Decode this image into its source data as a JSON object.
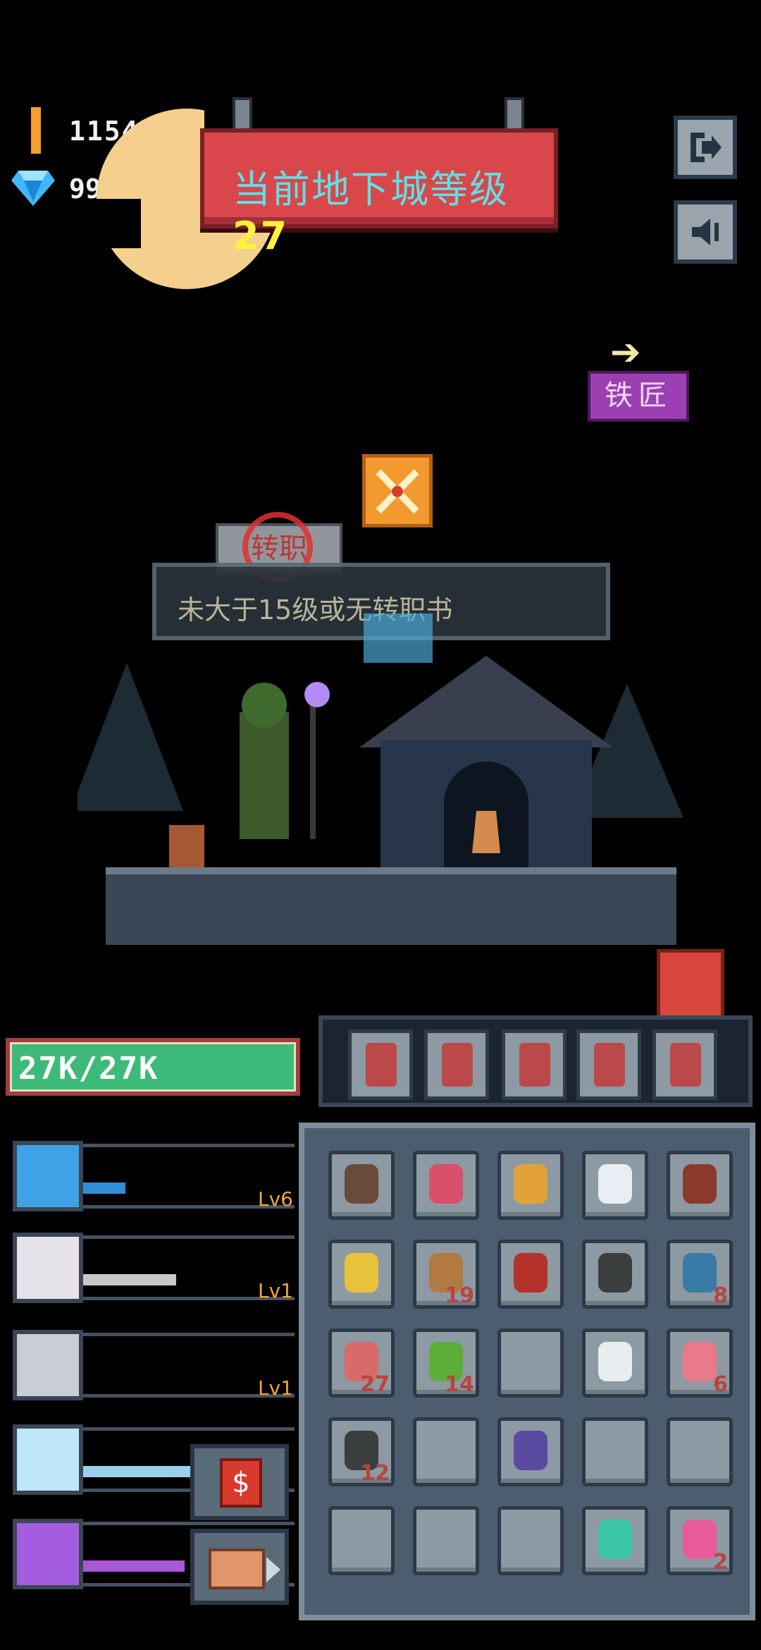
{
  "hud": {
    "gold": "11547",
    "gems": "99"
  },
  "banner": {
    "label": "当前地下城等级",
    "level": "27"
  },
  "side_buttons": {
    "exit_icon": "exit-door-icon",
    "sound_icon": "speaker-icon"
  },
  "blacksmith": {
    "label": "铁匠",
    "arrow": "➔"
  },
  "job_change": {
    "button_label": "转职",
    "locked_message": "未大于15级或无转职书"
  },
  "hp": {
    "text": "27K/27K"
  },
  "equipment": [
    {
      "icon": "bow-icon"
    },
    {
      "icon": "shield-icon"
    },
    {
      "icon": "scroll-icon"
    },
    {
      "icon": "axe-icon"
    },
    {
      "icon": "bow-icon"
    }
  ],
  "skills": [
    {
      "icon": "crossed-swords-icon",
      "level": "Lv6",
      "fill": 0.25,
      "color": "#2f8fd6"
    },
    {
      "icon": "beast-icon",
      "level": "Lv1",
      "fill": 0.55,
      "color": "#c8c8c8"
    },
    {
      "icon": "sword-icon",
      "level": "Lv1",
      "fill": 0.0,
      "color": "#888888"
    },
    {
      "icon": "staff-icon",
      "level": "",
      "fill": 1.0,
      "color": "#9ad0ec"
    },
    {
      "icon": "arrows-icon",
      "level": "",
      "fill": 0.6,
      "color": "#a957d6"
    }
  ],
  "inventory": [
    {
      "icon": "ring-icon",
      "count": ""
    },
    {
      "icon": "jester-hat-icon",
      "count": ""
    },
    {
      "icon": "gold-ring-icon",
      "count": ""
    },
    {
      "icon": "silver-ring-icon",
      "count": ""
    },
    {
      "icon": "spellbook-icon",
      "count": ""
    },
    {
      "icon": "golden-staff-icon",
      "count": ""
    },
    {
      "icon": "gourd-icon",
      "count": "19"
    },
    {
      "icon": "red-book-icon",
      "count": ""
    },
    {
      "icon": "stone-icon",
      "count": ""
    },
    {
      "icon": "blue-potion-icon",
      "count": "8"
    },
    {
      "icon": "red-potion-icon",
      "count": "27"
    },
    {
      "icon": "green-jar-icon",
      "count": "14"
    },
    {
      "icon": "",
      "count": ""
    },
    {
      "icon": "white-potion-icon",
      "count": ""
    },
    {
      "icon": "pink-potion-icon",
      "count": "6"
    },
    {
      "icon": "stone-icon",
      "count": "12"
    },
    {
      "icon": "",
      "count": ""
    },
    {
      "icon": "shield-icon",
      "count": ""
    },
    {
      "icon": "",
      "count": ""
    },
    {
      "icon": "",
      "count": ""
    },
    {
      "icon": "",
      "count": ""
    },
    {
      "icon": "",
      "count": ""
    },
    {
      "icon": "",
      "count": ""
    },
    {
      "icon": "teal-scroll-icon",
      "count": ""
    },
    {
      "icon": "pink-scroll-icon",
      "count": "2"
    }
  ],
  "bottom_buttons": {
    "shop": "$"
  }
}
